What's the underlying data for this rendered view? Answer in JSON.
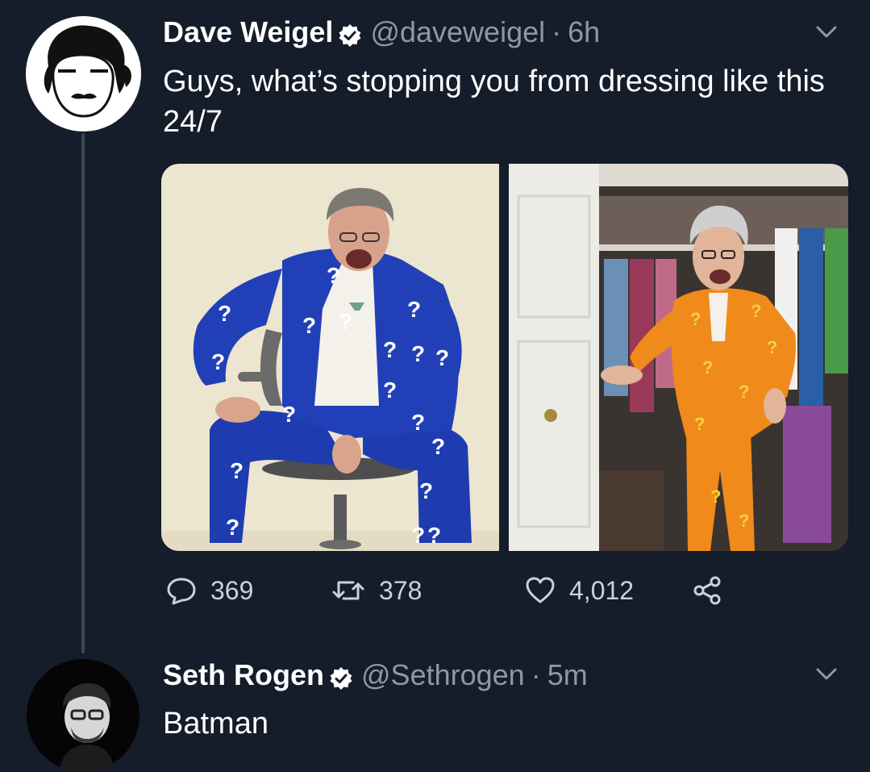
{
  "tweets": [
    {
      "display_name": "Dave Weigel",
      "handle": "@daveweigel",
      "separator": "·",
      "time": "6h",
      "text": "Guys, what’s stopping you from dressing like this 24/7",
      "avatar_icon": "cartoon-face-avatar-icon",
      "media": [
        {
          "icon": "man-in-blue-question-mark-suit-photo"
        },
        {
          "icon": "man-in-orange-question-mark-suit-photo"
        }
      ],
      "actions": {
        "replies": "369",
        "retweets": "378",
        "likes": "4,012"
      }
    },
    {
      "display_name": "Seth Rogen",
      "handle": "@Sethrogen",
      "separator": "·",
      "time": "5m",
      "text": "Batman",
      "avatar_icon": "portrait-avatar-icon"
    }
  ],
  "colors": {
    "background": "#151c2a",
    "verified_badge": "#ffffff",
    "secondary_text": "#8b98a8",
    "action_text": "#c9d1db",
    "thread_line": "#3d4654"
  }
}
